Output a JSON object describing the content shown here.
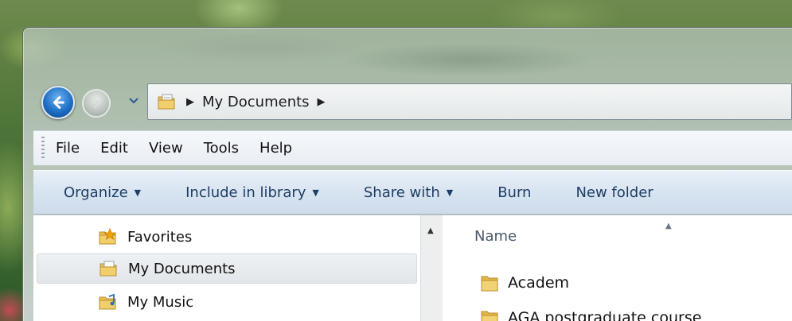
{
  "address_bar": {
    "breadcrumb": [
      "My Documents"
    ]
  },
  "menu_bar": {
    "items": [
      "File",
      "Edit",
      "View",
      "Tools",
      "Help"
    ]
  },
  "command_bar": {
    "organize": "Organize",
    "include_in_library": "Include in library",
    "share_with": "Share with",
    "burn": "Burn",
    "new_folder": "New folder"
  },
  "nav_pane": {
    "items": [
      {
        "label": "Favorites",
        "icon": "favorites-icon"
      },
      {
        "label": "My Documents",
        "icon": "documents-folder-icon",
        "selected": true
      },
      {
        "label": "My Music",
        "icon": "music-folder-icon"
      }
    ]
  },
  "file_list": {
    "column_name": "Name",
    "rows": [
      {
        "name": "Academ",
        "icon": "folder-icon"
      },
      {
        "name": "AGA postgraduate course",
        "icon": "folder-icon"
      }
    ]
  },
  "colors": {
    "command_text": "#1e3e63",
    "back_button": "#1f6fc6",
    "folder_yellow": "#e9c15a",
    "selection": "#e2e6ea"
  }
}
